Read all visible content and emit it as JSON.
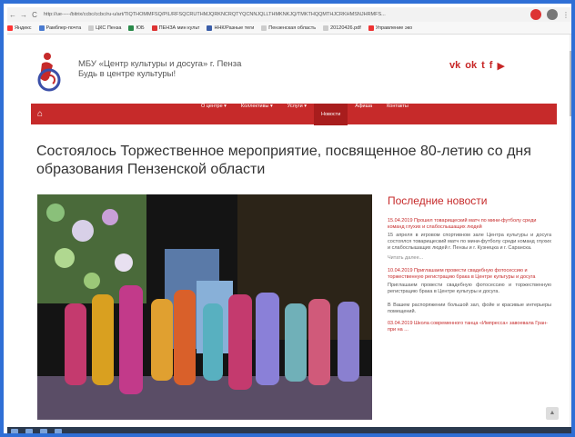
{
  "browser": {
    "url": "http://ue-----/bitrix/ccbc/ccbc/ru-u/art/TIQTHOMMFSQ/PIL/RFSQCRUTHMJQRKNCRQTYQCNNJQLLTHMKNKJQ/TMKTHQQMTHJCRKHMSNJHRMFS...",
    "bookmarks": [
      "Яндекс",
      "Рамблер-почта",
      "ЦКС Пенза",
      "ЮБ",
      "ПЕНЗА мин культ",
      "ННК/Разные теги",
      "Пензенская область",
      "20120426.pdf",
      "Управление эко"
    ]
  },
  "site": {
    "org_line1": "МБУ «Центр культуры и досуга» г. Пенза",
    "org_line2": "Будь в центре культуры!",
    "social": [
      "vk",
      "ok",
      "twitter",
      "facebook",
      "youtube"
    ],
    "menu": [
      "О центре ▾",
      "Коллективы ▾",
      "Услуги ▾",
      "Новости",
      "Афиша",
      "Контакты"
    ],
    "menu_active": "Новости"
  },
  "article": {
    "title": "Состоялось Торжественное мероприятие, посвященное 80-летию со дня образования Пензенской области"
  },
  "sidebar": {
    "heading": "Последние новости",
    "news": [
      {
        "title": "15.04.2019 Прошел товарищеский матч по мини-футболу среди команд глухих и слабослышащих людей",
        "text": "15 апреля в игровом спортивном зале Центра культуры и досуга состоялся товарищеский матч по мини-футболу среди команд глухих и слабослышащих людей г. Пензы и г. Кузнецка и г. Саранска.",
        "more": "Читать далее..."
      },
      {
        "title": "10.04.2019 Приглашаем провести свадебную фотосессию и торжественную регистрацию брака в Центре культуры и досуга",
        "text": "Приглашаем провести свадебную фотосессию и торжественную регистрацию брака в Центре культуры и досуга.",
        "text2": "В Вашем распоряжении большой зал, фойе и красивые интерьеры помещений.",
        "more": ""
      },
      {
        "title": "03.04.2019 Школа современного танца «Импресса» завоевала Гран-при на ...",
        "text": "",
        "more": ""
      }
    ]
  }
}
